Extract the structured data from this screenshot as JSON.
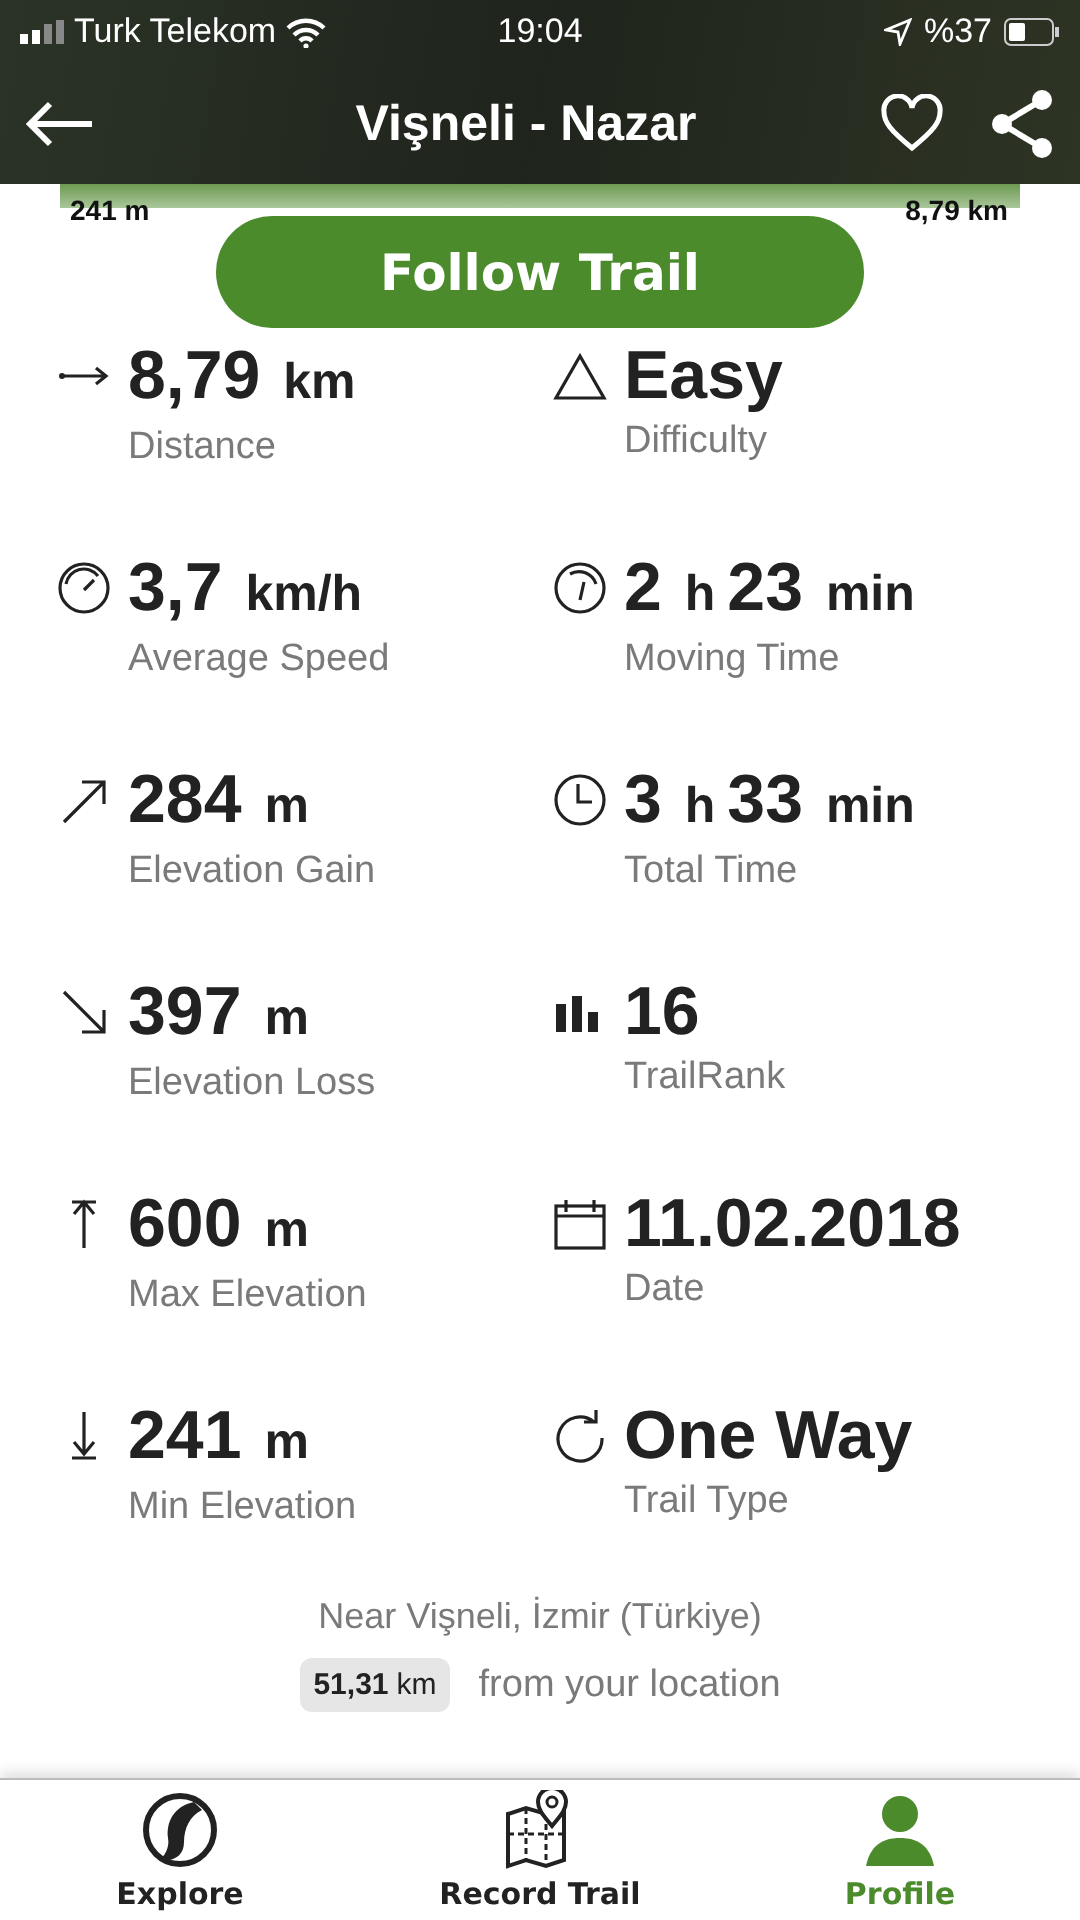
{
  "status_bar": {
    "carrier": "Turk Telekom",
    "time": "19:04",
    "battery": "%37"
  },
  "header": {
    "title": "Vişneli - Nazar"
  },
  "elevation_profile": {
    "start_label": "241 m",
    "end_label": "8,79 km"
  },
  "follow_button": "Follow Trail",
  "stats": [
    {
      "kind": "distance",
      "value_parts": [
        {
          "kind": "number",
          "text": "8,79"
        },
        {
          "kind": "unit",
          "text": "km"
        }
      ],
      "label": "Distance"
    },
    {
      "kind": "difficulty",
      "value_parts": [
        {
          "kind": "number",
          "text": "Easy"
        }
      ],
      "label": "Difficulty"
    },
    {
      "kind": "speed",
      "value_parts": [
        {
          "kind": "number",
          "text": "3,7"
        },
        {
          "kind": "unit",
          "text": "km/h"
        }
      ],
      "label": "Average Speed"
    },
    {
      "kind": "moving-time",
      "value_parts": [
        {
          "kind": "number",
          "text": "2"
        },
        {
          "kind": "unit",
          "text": "h"
        },
        {
          "kind": "number",
          "text": "23"
        },
        {
          "kind": "unit",
          "text": "min"
        }
      ],
      "label": "Moving Time"
    },
    {
      "kind": "elevation-gain",
      "value_parts": [
        {
          "kind": "number",
          "text": "284"
        },
        {
          "kind": "unit",
          "text": "m"
        }
      ],
      "label": "Elevation Gain"
    },
    {
      "kind": "total-time",
      "value_parts": [
        {
          "kind": "number",
          "text": "3"
        },
        {
          "kind": "unit",
          "text": "h"
        },
        {
          "kind": "number",
          "text": "33"
        },
        {
          "kind": "unit",
          "text": "min"
        }
      ],
      "label": "Total Time"
    },
    {
      "kind": "elevation-loss",
      "value_parts": [
        {
          "kind": "number",
          "text": "397"
        },
        {
          "kind": "unit",
          "text": "m"
        }
      ],
      "label": "Elevation Loss"
    },
    {
      "kind": "rank",
      "value_parts": [
        {
          "kind": "number",
          "text": "16"
        }
      ],
      "label": "TrailRank"
    },
    {
      "kind": "max-elevation",
      "value_parts": [
        {
          "kind": "number",
          "text": "600"
        },
        {
          "kind": "unit",
          "text": "m"
        }
      ],
      "label": "Max Elevation"
    },
    {
      "kind": "date",
      "value_parts": [
        {
          "kind": "number",
          "text": "11.02.2018"
        }
      ],
      "label": "Date"
    },
    {
      "kind": "min-elevation",
      "value_parts": [
        {
          "kind": "number",
          "text": "241"
        },
        {
          "kind": "unit",
          "text": "m"
        }
      ],
      "label": "Min Elevation"
    },
    {
      "kind": "trail-type",
      "value_parts": [
        {
          "kind": "number",
          "text": "One Way"
        }
      ],
      "label": "Trail Type"
    }
  ],
  "location": {
    "text": "Near Vişneli, İzmir (Türkiye)",
    "distance_number": "51,31",
    "distance_unit": "km",
    "suffix": "from your location"
  },
  "tab_bar": [
    {
      "kind": "explore",
      "label": "Explore",
      "selected": false
    },
    {
      "kind": "record",
      "label": "Record Trail",
      "selected": false
    },
    {
      "kind": "profile",
      "label": "Profile",
      "selected": true
    }
  ]
}
